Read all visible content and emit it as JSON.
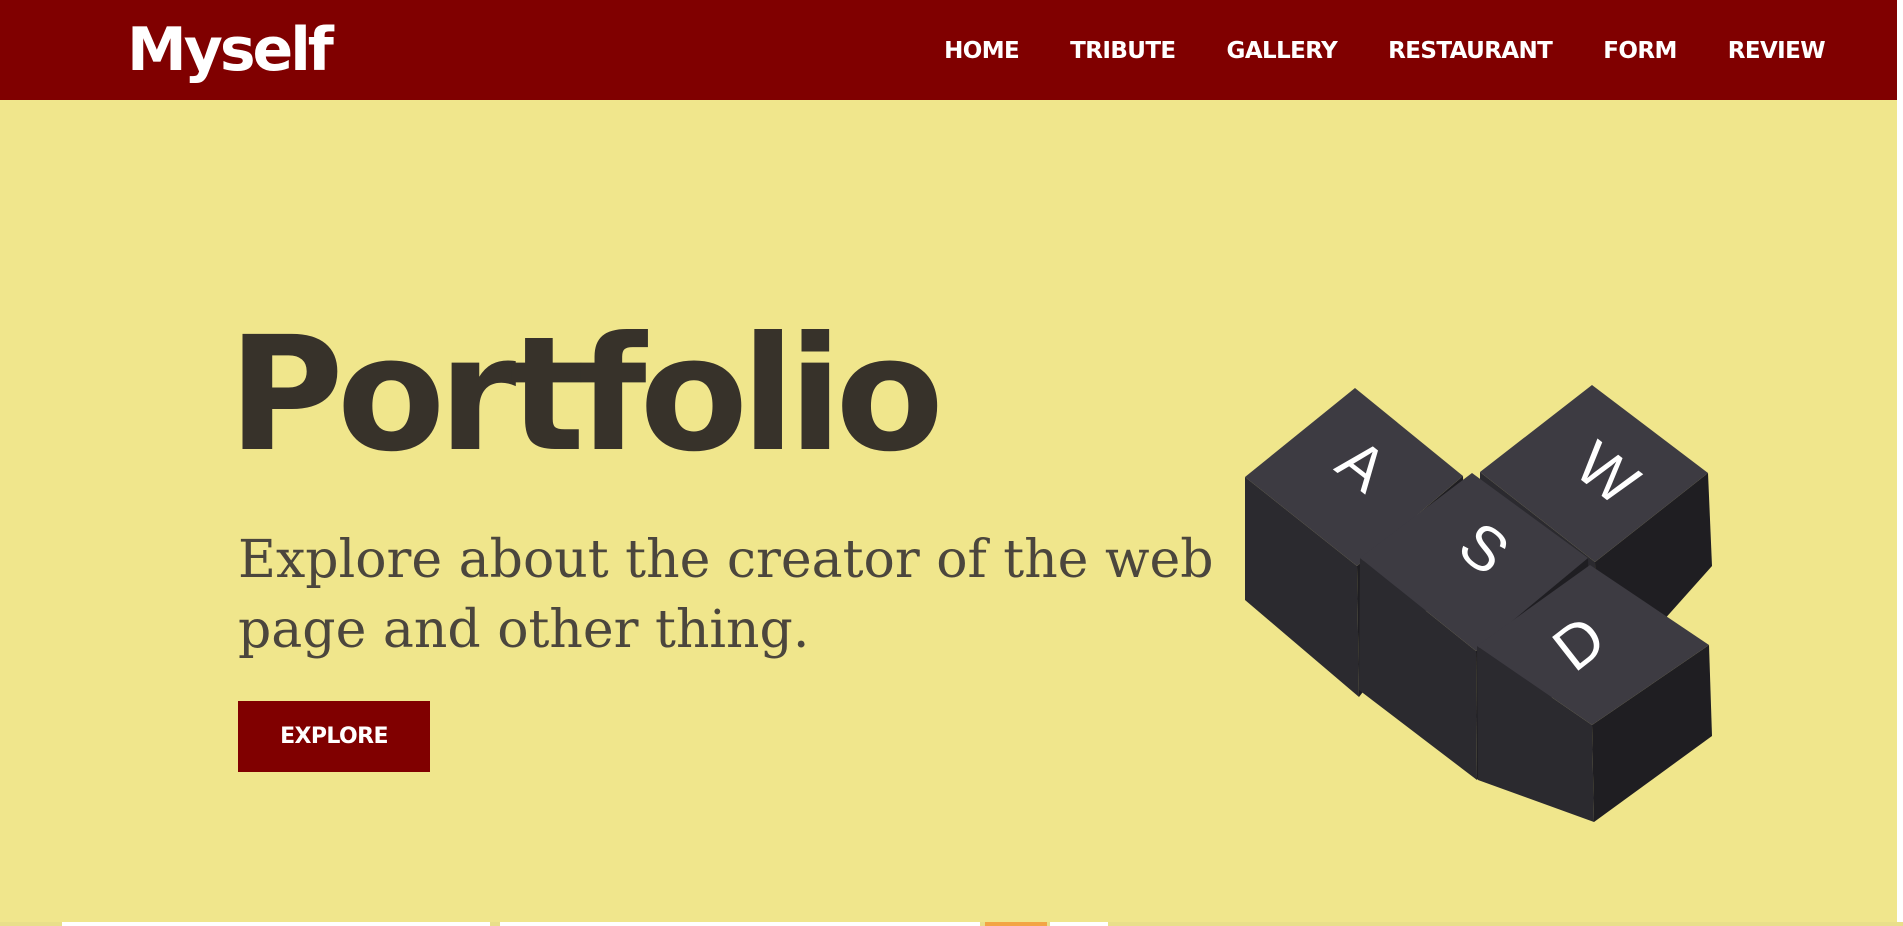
{
  "brand": "Myself",
  "nav": {
    "items": [
      {
        "label": "HOME"
      },
      {
        "label": "TRIBUTE"
      },
      {
        "label": "GALLERY"
      },
      {
        "label": "RESTAURANT"
      },
      {
        "label": "FORM"
      },
      {
        "label": "REVIEW"
      }
    ]
  },
  "hero": {
    "title": "Portfolio",
    "subtitle": "Explore about the creator of the web page and other thing.",
    "button_label": "EXPLORE",
    "keycaps": [
      "A",
      "W",
      "S",
      "D"
    ]
  },
  "colors": {
    "navbar": "#800000",
    "hero_background": "#f0e68c",
    "title_text": "#37322a",
    "subtitle_text": "#4b463d",
    "button_background": "#800000",
    "keycap_top": "#3d3b42",
    "keycap_side": "#232226"
  }
}
